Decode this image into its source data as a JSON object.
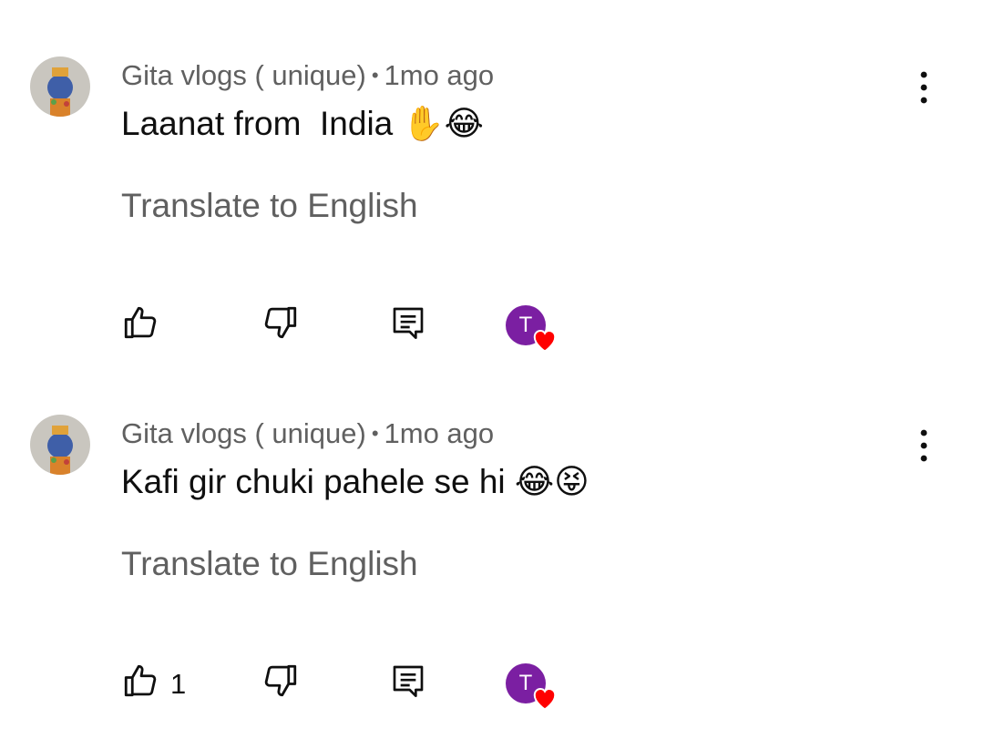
{
  "colors": {
    "secondary_text": "#606060",
    "primary_text": "#0f0f0f",
    "creator_avatar_bg": "#7b1fa2",
    "heart": "#ff0000"
  },
  "comments": [
    {
      "author": "Gita vlogs ( unique)",
      "separator": "•",
      "time": "1mo ago",
      "text": "Laanat from  India",
      "emojis": "✋😂",
      "translate_label": "Translate to English",
      "like_count": "",
      "creator_initial": "T",
      "icons": {
        "like": "thumbs-up-icon",
        "dislike": "thumbs-down-icon",
        "reply": "comment-icon",
        "menu": "more-vert-icon",
        "heart": "heart-icon"
      }
    },
    {
      "author": "Gita vlogs ( unique)",
      "separator": "•",
      "time": "1mo ago",
      "text": "Kafi gir chuki pahele se hi",
      "emojis": "😂😝",
      "translate_label": "Translate to English",
      "like_count": "1",
      "creator_initial": "T",
      "icons": {
        "like": "thumbs-up-icon",
        "dislike": "thumbs-down-icon",
        "reply": "comment-icon",
        "menu": "more-vert-icon",
        "heart": "heart-icon"
      }
    }
  ]
}
